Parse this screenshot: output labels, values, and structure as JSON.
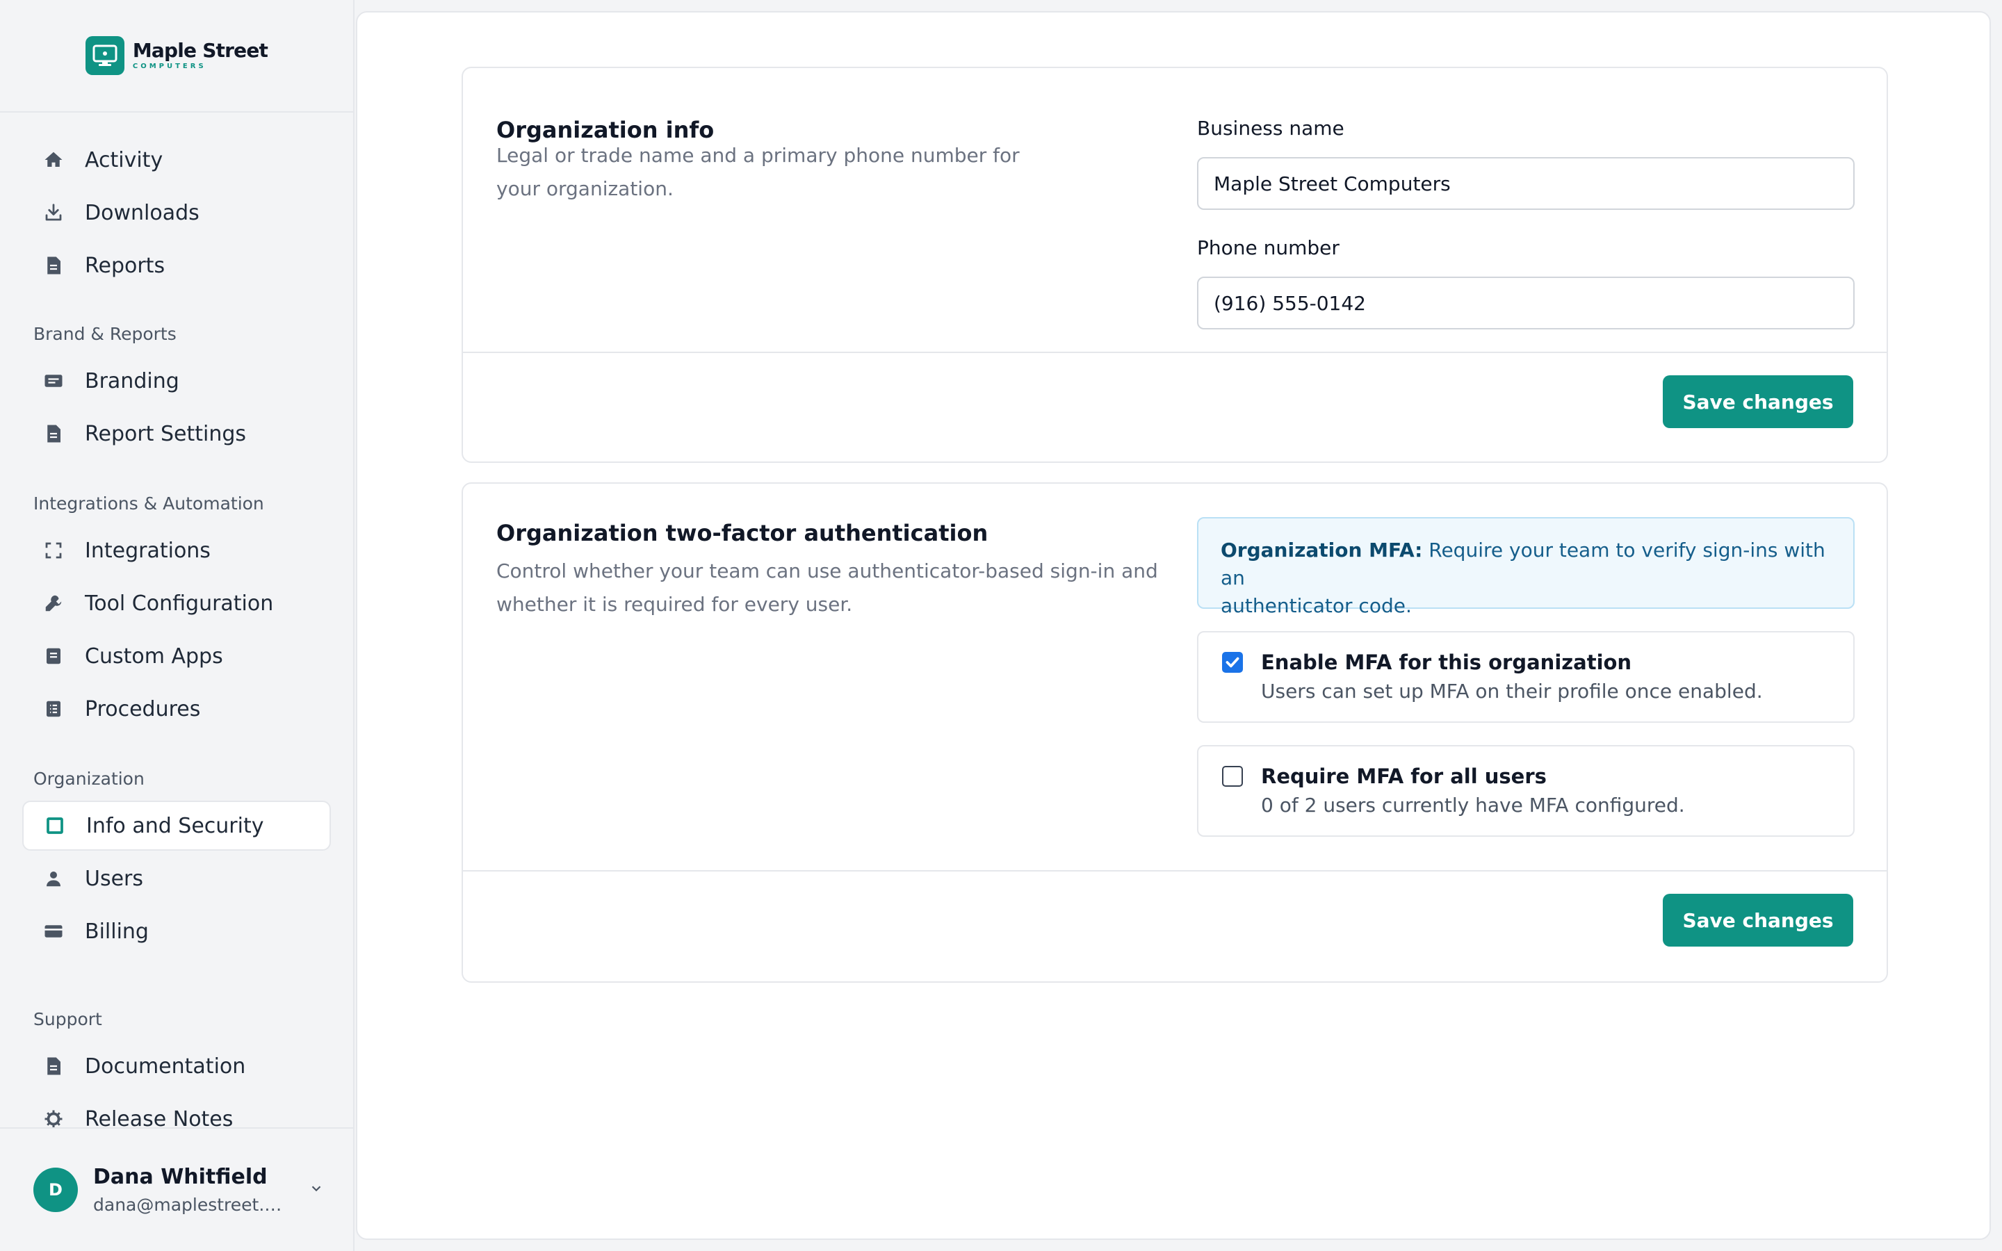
{
  "brand": {
    "name": "Maple Street",
    "subtitle": "COMPUTERS",
    "accent": "#0f9384"
  },
  "sidebar": {
    "primary_items": [
      {
        "label": "Activity",
        "icon": "home-icon"
      },
      {
        "label": "Downloads",
        "icon": "download-icon"
      },
      {
        "label": "Reports",
        "icon": "document-icon"
      }
    ],
    "sections": [
      {
        "title": "Brand & Reports",
        "items": [
          {
            "label": "Branding",
            "icon": "card-icon"
          },
          {
            "label": "Report Settings",
            "icon": "document-icon"
          }
        ]
      },
      {
        "title": "Integrations & Automation",
        "items": [
          {
            "label": "Integrations",
            "icon": "integration-icon"
          },
          {
            "label": "Tool Configuration",
            "icon": "tool-icon"
          },
          {
            "label": "Custom Apps",
            "icon": "app-icon"
          },
          {
            "label": "Procedures",
            "icon": "list-icon"
          }
        ]
      },
      {
        "title": "Organization",
        "items": [
          {
            "label": "Info and Security",
            "icon": "square-icon",
            "active": true
          },
          {
            "label": "Users",
            "icon": "user-icon"
          },
          {
            "label": "Billing",
            "icon": "card-icon"
          }
        ]
      },
      {
        "title": "Support",
        "items": [
          {
            "label": "Documentation",
            "icon": "document-icon"
          },
          {
            "label": "Release Notes",
            "icon": "gear-icon"
          }
        ]
      }
    ],
    "user": {
      "initial": "D",
      "name": "Dana Whitfield",
      "email": "dana@maplestreet.e..."
    }
  },
  "org_info": {
    "title": "Organization info",
    "description_line1": "Legal or trade name and a primary phone number for",
    "description_line2": "your organization.",
    "business_name_label": "Business name",
    "business_name_value": "Maple Street Computers",
    "phone_label": "Phone number",
    "phone_value": "(916) 555-0142",
    "save_label": "Save changes"
  },
  "mfa": {
    "title": "Organization two-factor authentication",
    "description_line1": "Control whether your team can use authenticator-based sign-in and",
    "description_line2": "whether it is required for every user.",
    "banner_bold": "Organization MFA:",
    "banner_text_line1": "Require your team to verify sign-ins with an",
    "banner_text_line2": "authenticator code.",
    "options": [
      {
        "title": "Enable MFA for this organization",
        "subtitle": "Users can set up MFA on their profile once enabled.",
        "checked": true
      },
      {
        "title": "Require MFA for all users",
        "subtitle": "0 of 2 users currently have MFA configured.",
        "checked": false
      }
    ],
    "save_label": "Save changes"
  }
}
